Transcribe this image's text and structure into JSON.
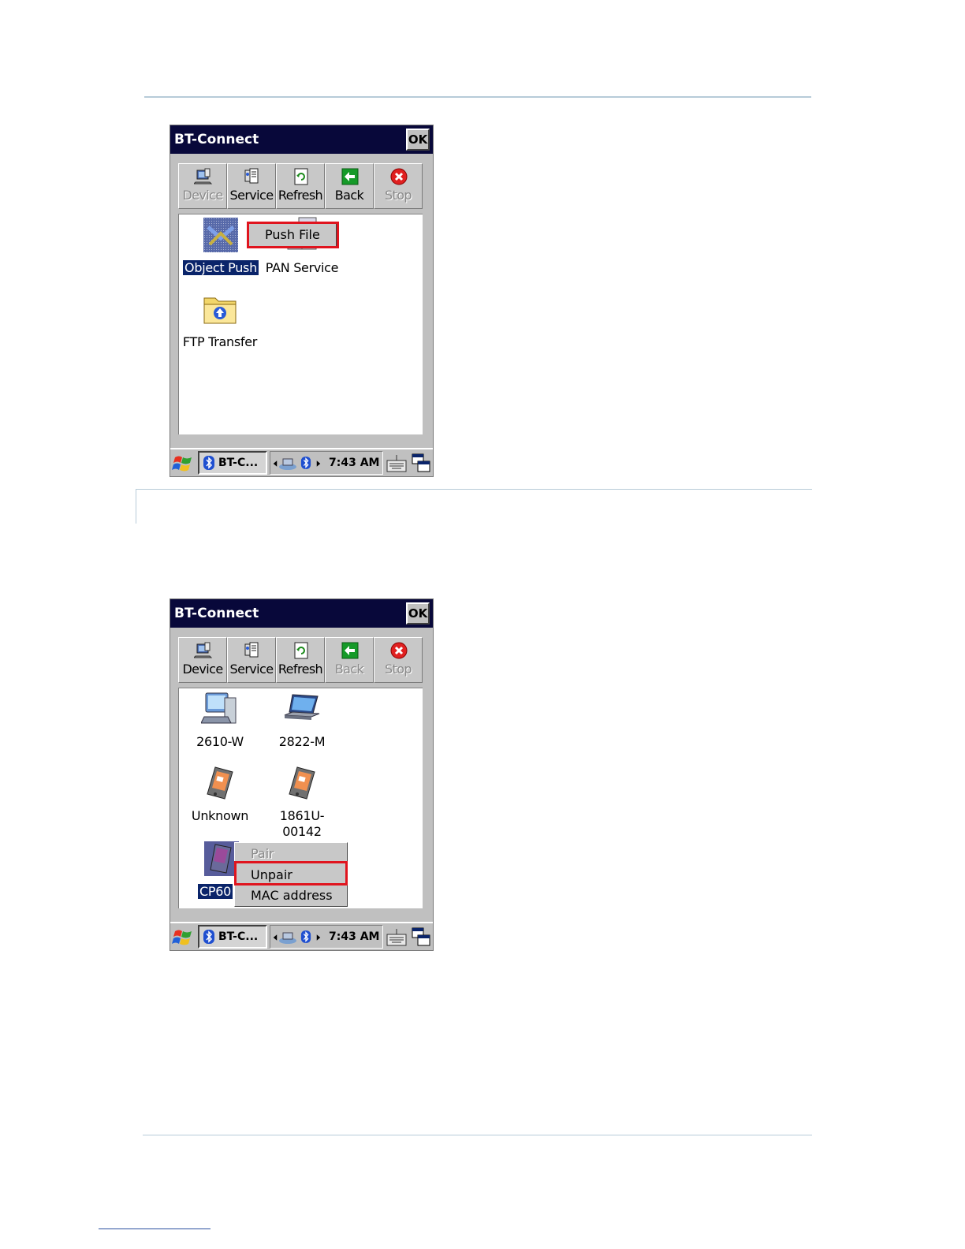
{
  "screenshots": [
    {
      "title": "BT-Connect",
      "ok_label": "OK",
      "toolbar": [
        {
          "label": "Device",
          "icon": "device-icon",
          "enabled": false
        },
        {
          "label": "Service",
          "icon": "service-icon",
          "enabled": true
        },
        {
          "label": "Refresh",
          "icon": "refresh-icon",
          "enabled": true
        },
        {
          "label": "Back",
          "icon": "back-arrow-icon",
          "enabled": true
        },
        {
          "label": "Stop",
          "icon": "stop-icon",
          "enabled": false
        }
      ],
      "items": [
        {
          "label": "Object Push",
          "icon": "object-push-icon",
          "selected": true
        },
        {
          "label": "PAN Service",
          "icon": "pan-service-icon",
          "selected": false
        },
        {
          "label": "FTP Transfer",
          "icon": "ftp-folder-icon",
          "selected": false
        }
      ],
      "context_menu": [
        {
          "label": "Push File",
          "enabled": true
        }
      ],
      "taskbar": {
        "task_label": "BT-C...",
        "clock": "7:43 AM"
      }
    },
    {
      "title": "BT-Connect",
      "ok_label": "OK",
      "toolbar": [
        {
          "label": "Device",
          "icon": "device-icon",
          "enabled": true
        },
        {
          "label": "Service",
          "icon": "service-icon",
          "enabled": true
        },
        {
          "label": "Refresh",
          "icon": "refresh-icon",
          "enabled": true
        },
        {
          "label": "Back",
          "icon": "back-arrow-icon",
          "enabled": false
        },
        {
          "label": "Stop",
          "icon": "stop-icon",
          "enabled": false
        }
      ],
      "items": [
        {
          "label": "2610-W",
          "icon": "desktop-computer-icon",
          "selected": false
        },
        {
          "label": "2822-M",
          "icon": "laptop-icon",
          "selected": false
        },
        {
          "label": "Unknown",
          "icon": "pda-icon",
          "selected": false
        },
        {
          "label": "1861U-",
          "label2": "00142",
          "icon": "pda-icon",
          "selected": false
        },
        {
          "label": "CP60",
          "icon": "handheld-device-icon",
          "selected": true
        }
      ],
      "context_menu": [
        {
          "label": "Pair",
          "enabled": false
        },
        {
          "label": "Unpair",
          "enabled": true
        },
        {
          "label": "MAC address",
          "enabled": true
        }
      ],
      "taskbar": {
        "task_label": "BT-C...",
        "clock": "7:43 AM"
      }
    }
  ]
}
